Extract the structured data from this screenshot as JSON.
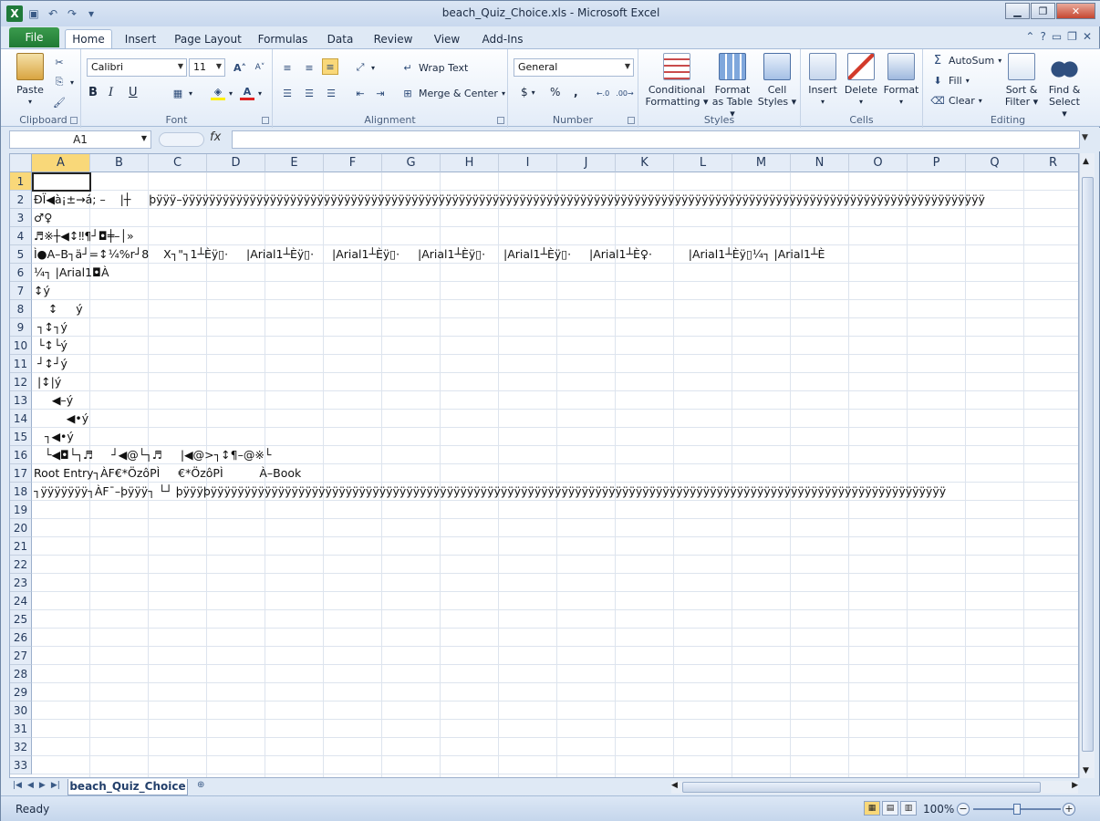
{
  "window": {
    "title": "beach_Quiz_Choice.xls  -  Microsoft Excel"
  },
  "qat": {
    "app_icon": "X"
  },
  "ribbon": {
    "tabs": [
      "File",
      "Home",
      "Insert",
      "Page Layout",
      "Formulas",
      "Data",
      "Review",
      "View",
      "Add-Ins"
    ],
    "active_tab": "Home",
    "clipboard": {
      "label": "Clipboard",
      "paste": "Paste"
    },
    "font": {
      "label": "Font",
      "name": "Calibri",
      "size": "11",
      "bold": "B",
      "italic": "I",
      "underline": "U"
    },
    "alignment": {
      "label": "Alignment",
      "wrap": "Wrap Text",
      "merge": "Merge & Center"
    },
    "number": {
      "label": "Number",
      "format": "General",
      "currency": "$",
      "percent": "%",
      "comma": ","
    },
    "styles": {
      "label": "Styles",
      "cond1": "Conditional",
      "cond2": "Formatting",
      "fmt1": "Format",
      "fmt2": "as Table",
      "cell1": "Cell",
      "cell2": "Styles"
    },
    "cells": {
      "label": "Cells",
      "insert": "Insert",
      "delete": "Delete",
      "format": "Format"
    },
    "editing": {
      "label": "Editing",
      "autosum": "AutoSum",
      "fill": "Fill",
      "clear": "Clear",
      "sort1": "Sort &",
      "sort2": "Filter",
      "find1": "Find &",
      "find2": "Select"
    }
  },
  "formula_bar": {
    "name_box": "A1",
    "fx": "fx",
    "value": ""
  },
  "columns": [
    "A",
    "B",
    "C",
    "D",
    "E",
    "F",
    "G",
    "H",
    "I",
    "J",
    "K",
    "L",
    "M",
    "N",
    "O",
    "P",
    "Q",
    "R"
  ],
  "rows": [
    "1",
    "2",
    "3",
    "4",
    "5",
    "6",
    "7",
    "8",
    "9",
    "10",
    "11",
    "12",
    "13",
    "14",
    "15",
    "16",
    "17",
    "18",
    "19",
    "20",
    "21",
    "22",
    "23",
    "24",
    "25",
    "26",
    "27",
    "28",
    "29",
    "30",
    "31",
    "32",
    "33"
  ],
  "cells": {
    "r2": "ÐÏ◀à¡±→á; –    |┼     þÿÿÿ–ÿÿÿÿÿÿÿÿÿÿÿÿÿÿÿÿÿÿÿÿÿÿÿÿÿÿÿÿÿÿÿÿÿÿÿÿÿÿÿÿÿÿÿÿÿÿÿÿÿÿÿÿÿÿÿÿÿÿÿÿÿÿÿÿÿÿÿÿÿÿÿÿÿÿÿÿÿÿÿÿÿÿÿÿÿÿÿÿÿÿÿÿÿÿÿÿÿÿÿÿÿÿÿÿÿÿÿÿÿÿÿÿÿÿÿÿÿÿÿ",
    "r3": "♂♀",
    "r4": "♬※┼◀↕‼¶┘◘╪–│»",
    "r5": "Ì●A–B┐ä┘=↕¼%r┘8    X┐\"┐1┴Èÿ▯·     |Arial1┴Èÿ▯·     |Arial1┴Èÿ▯·     |Arial1┴Èÿ▯·     |Arial1┴Èÿ▯·     |Arial1┴È♀·          |Arial1┴Èÿ▯¼┐ |Arial1┴È",
    "r6": "¼┐ |Arial1◘À",
    "r7": "↕ý",
    "r8": "    ↕     ý",
    "r9": " ┐↕┐ý",
    "r10": " └↕└ý",
    "r11": " ┘↕┘ý",
    "r12": " |↕|ý",
    "r13": "     ◀–ý",
    "r14": "         ◀•ý",
    "r15": "   ┐◀•ý",
    "r16": "   └◀◘└┐♬     ┘◀@└┐♬     |◀@>┐↕¶–@※└",
    "r17": "Root Entry┐ÀF€*ÖzôPÌ     €*ÖzôPÌ          À–Book",
    "r18": "┐ÿÿÿÿÿÿÿ┐ÀF¯–þÿÿÿ┐ └┘ þÿÿÿþÿÿÿÿÿÿÿÿÿÿÿÿÿÿÿÿÿÿÿÿÿÿÿÿÿÿÿÿÿÿÿÿÿÿÿÿÿÿÿÿÿÿÿÿÿÿÿÿÿÿÿÿÿÿÿÿÿÿÿÿÿÿÿÿÿÿÿÿÿÿÿÿÿÿÿÿÿÿÿÿÿÿÿÿÿÿÿÿÿÿÿÿÿÿÿÿÿÿÿÿÿÿÿÿÿÿÿÿÿ"
  },
  "sheet": {
    "tab": "beach_Quiz_Choice"
  },
  "status": {
    "text": "Ready",
    "zoom": "100%"
  },
  "colors": {
    "accent": "#1f7a34",
    "selection": "#f9d879",
    "header_bg": "#e4ecf7"
  }
}
